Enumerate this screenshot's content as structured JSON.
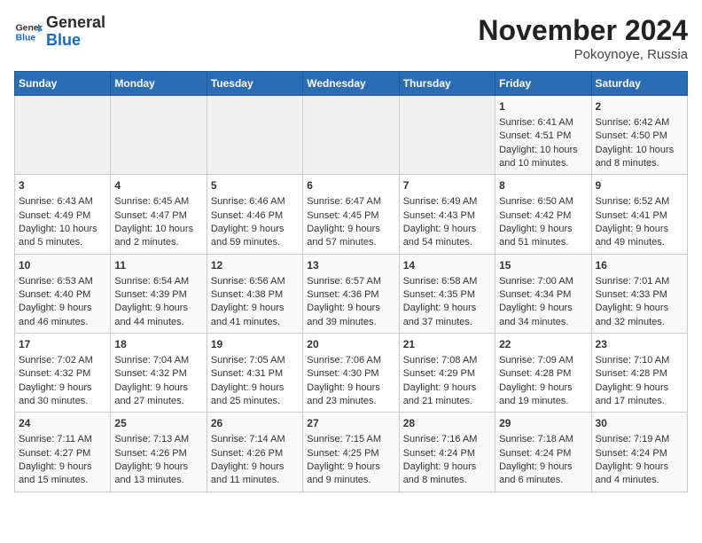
{
  "header": {
    "logo_line1": "General",
    "logo_line2": "Blue",
    "month": "November 2024",
    "location": "Pokoynoye, Russia"
  },
  "days_of_week": [
    "Sunday",
    "Monday",
    "Tuesday",
    "Wednesday",
    "Thursday",
    "Friday",
    "Saturday"
  ],
  "weeks": [
    [
      {
        "day": "",
        "info": ""
      },
      {
        "day": "",
        "info": ""
      },
      {
        "day": "",
        "info": ""
      },
      {
        "day": "",
        "info": ""
      },
      {
        "day": "",
        "info": ""
      },
      {
        "day": "1",
        "info": "Sunrise: 6:41 AM\nSunset: 4:51 PM\nDaylight: 10 hours and 10 minutes."
      },
      {
        "day": "2",
        "info": "Sunrise: 6:42 AM\nSunset: 4:50 PM\nDaylight: 10 hours and 8 minutes."
      }
    ],
    [
      {
        "day": "3",
        "info": "Sunrise: 6:43 AM\nSunset: 4:49 PM\nDaylight: 10 hours and 5 minutes."
      },
      {
        "day": "4",
        "info": "Sunrise: 6:45 AM\nSunset: 4:47 PM\nDaylight: 10 hours and 2 minutes."
      },
      {
        "day": "5",
        "info": "Sunrise: 6:46 AM\nSunset: 4:46 PM\nDaylight: 9 hours and 59 minutes."
      },
      {
        "day": "6",
        "info": "Sunrise: 6:47 AM\nSunset: 4:45 PM\nDaylight: 9 hours and 57 minutes."
      },
      {
        "day": "7",
        "info": "Sunrise: 6:49 AM\nSunset: 4:43 PM\nDaylight: 9 hours and 54 minutes."
      },
      {
        "day": "8",
        "info": "Sunrise: 6:50 AM\nSunset: 4:42 PM\nDaylight: 9 hours and 51 minutes."
      },
      {
        "day": "9",
        "info": "Sunrise: 6:52 AM\nSunset: 4:41 PM\nDaylight: 9 hours and 49 minutes."
      }
    ],
    [
      {
        "day": "10",
        "info": "Sunrise: 6:53 AM\nSunset: 4:40 PM\nDaylight: 9 hours and 46 minutes."
      },
      {
        "day": "11",
        "info": "Sunrise: 6:54 AM\nSunset: 4:39 PM\nDaylight: 9 hours and 44 minutes."
      },
      {
        "day": "12",
        "info": "Sunrise: 6:56 AM\nSunset: 4:38 PM\nDaylight: 9 hours and 41 minutes."
      },
      {
        "day": "13",
        "info": "Sunrise: 6:57 AM\nSunset: 4:36 PM\nDaylight: 9 hours and 39 minutes."
      },
      {
        "day": "14",
        "info": "Sunrise: 6:58 AM\nSunset: 4:35 PM\nDaylight: 9 hours and 37 minutes."
      },
      {
        "day": "15",
        "info": "Sunrise: 7:00 AM\nSunset: 4:34 PM\nDaylight: 9 hours and 34 minutes."
      },
      {
        "day": "16",
        "info": "Sunrise: 7:01 AM\nSunset: 4:33 PM\nDaylight: 9 hours and 32 minutes."
      }
    ],
    [
      {
        "day": "17",
        "info": "Sunrise: 7:02 AM\nSunset: 4:32 PM\nDaylight: 9 hours and 30 minutes."
      },
      {
        "day": "18",
        "info": "Sunrise: 7:04 AM\nSunset: 4:32 PM\nDaylight: 9 hours and 27 minutes."
      },
      {
        "day": "19",
        "info": "Sunrise: 7:05 AM\nSunset: 4:31 PM\nDaylight: 9 hours and 25 minutes."
      },
      {
        "day": "20",
        "info": "Sunrise: 7:06 AM\nSunset: 4:30 PM\nDaylight: 9 hours and 23 minutes."
      },
      {
        "day": "21",
        "info": "Sunrise: 7:08 AM\nSunset: 4:29 PM\nDaylight: 9 hours and 21 minutes."
      },
      {
        "day": "22",
        "info": "Sunrise: 7:09 AM\nSunset: 4:28 PM\nDaylight: 9 hours and 19 minutes."
      },
      {
        "day": "23",
        "info": "Sunrise: 7:10 AM\nSunset: 4:28 PM\nDaylight: 9 hours and 17 minutes."
      }
    ],
    [
      {
        "day": "24",
        "info": "Sunrise: 7:11 AM\nSunset: 4:27 PM\nDaylight: 9 hours and 15 minutes."
      },
      {
        "day": "25",
        "info": "Sunrise: 7:13 AM\nSunset: 4:26 PM\nDaylight: 9 hours and 13 minutes."
      },
      {
        "day": "26",
        "info": "Sunrise: 7:14 AM\nSunset: 4:26 PM\nDaylight: 9 hours and 11 minutes."
      },
      {
        "day": "27",
        "info": "Sunrise: 7:15 AM\nSunset: 4:25 PM\nDaylight: 9 hours and 9 minutes."
      },
      {
        "day": "28",
        "info": "Sunrise: 7:16 AM\nSunset: 4:24 PM\nDaylight: 9 hours and 8 minutes."
      },
      {
        "day": "29",
        "info": "Sunrise: 7:18 AM\nSunset: 4:24 PM\nDaylight: 9 hours and 6 minutes."
      },
      {
        "day": "30",
        "info": "Sunrise: 7:19 AM\nSunset: 4:24 PM\nDaylight: 9 hours and 4 minutes."
      }
    ]
  ]
}
